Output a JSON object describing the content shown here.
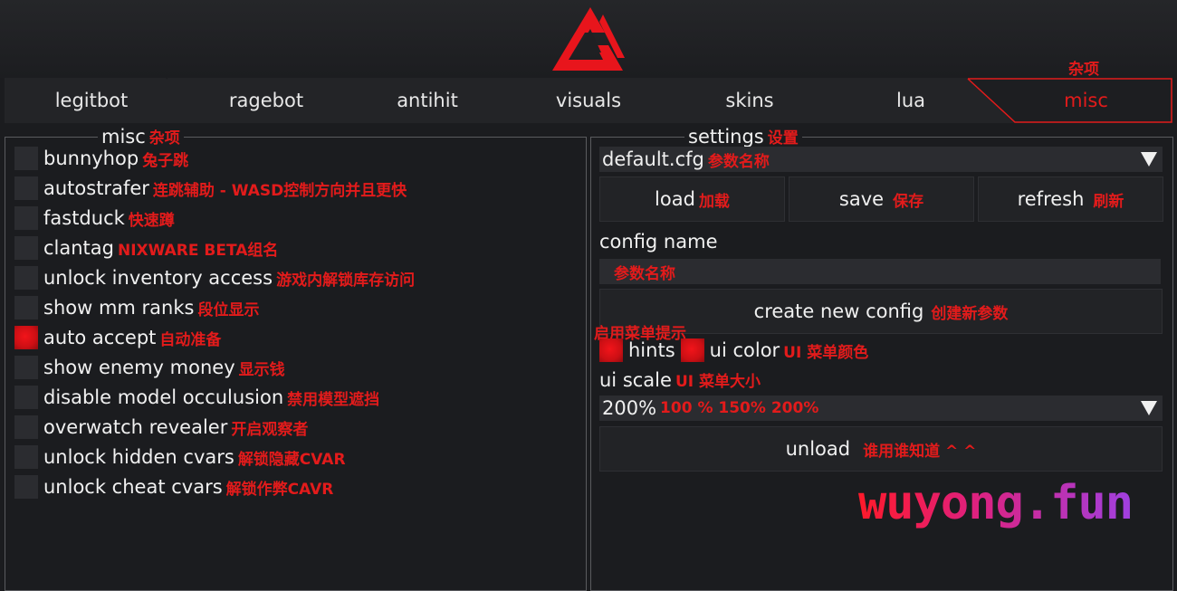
{
  "header": {
    "top_note": "杂项"
  },
  "tabs": [
    {
      "label": "legitbot"
    },
    {
      "label": "ragebot"
    },
    {
      "label": "antihit"
    },
    {
      "label": "visuals"
    },
    {
      "label": "skins"
    },
    {
      "label": "lua"
    },
    {
      "label": "misc"
    }
  ],
  "misc": {
    "title": "misc",
    "title_note": "杂项",
    "items": [
      {
        "label": "bunnyhop",
        "note": "兔子跳",
        "checked": false
      },
      {
        "label": "autostrafer",
        "note": "连跳辅助 - WASD控制方向并且更快",
        "checked": false
      },
      {
        "label": "fastduck",
        "note": "快速蹲",
        "checked": false
      },
      {
        "label": "clantag",
        "note": "NIXWARE BETA组名",
        "checked": false
      },
      {
        "label": "unlock inventory access",
        "note": "游戏内解锁库存访问",
        "checked": false
      },
      {
        "label": "show mm ranks",
        "note": "段位显示",
        "checked": false
      },
      {
        "label": "auto accept",
        "note": "自动准备",
        "checked": true
      },
      {
        "label": "show enemy money",
        "note": "显示钱",
        "checked": false
      },
      {
        "label": "disable model occulusion",
        "note": "禁用模型遮挡",
        "checked": false
      },
      {
        "label": "overwatch revealer",
        "note": "开启观察者",
        "checked": false
      },
      {
        "label": "unlock hidden cvars",
        "note": "解锁隐藏CVAR",
        "checked": false
      },
      {
        "label": "unlock cheat cvars",
        "note": "解锁作弊CAVR",
        "checked": false
      }
    ]
  },
  "settings": {
    "title": "settings",
    "title_note": "设置",
    "config_select": {
      "value": "default.cfg",
      "note": "参数名称"
    },
    "buttons": [
      {
        "label": "load",
        "note": "加载"
      },
      {
        "label": "save",
        "note": "保存"
      },
      {
        "label": "refresh",
        "note": "刷新"
      }
    ],
    "config_name_label": "config name",
    "config_name_placeholder": "参数名称",
    "create_label": "create new config",
    "create_note": "创建新参数",
    "hints_note": "启用菜单提示",
    "hints_label": "hints",
    "hints_checked": true,
    "ui_color_label": "ui color",
    "ui_color_note": "UI 菜单颜色",
    "ui_color": "#e21b1b",
    "ui_scale_label": "ui scale",
    "ui_scale_note": "UI 菜单大小",
    "ui_scale_value": "200%",
    "ui_scale_options_note": "100 % 150% 200%",
    "unload_label": "unload",
    "unload_note": "谁用谁知道 ^ ^"
  },
  "watermark": "wuyong.fun",
  "colors": {
    "accent": "#e21b1b",
    "bg": "#1b1c1f",
    "field": "#2b2c30"
  }
}
